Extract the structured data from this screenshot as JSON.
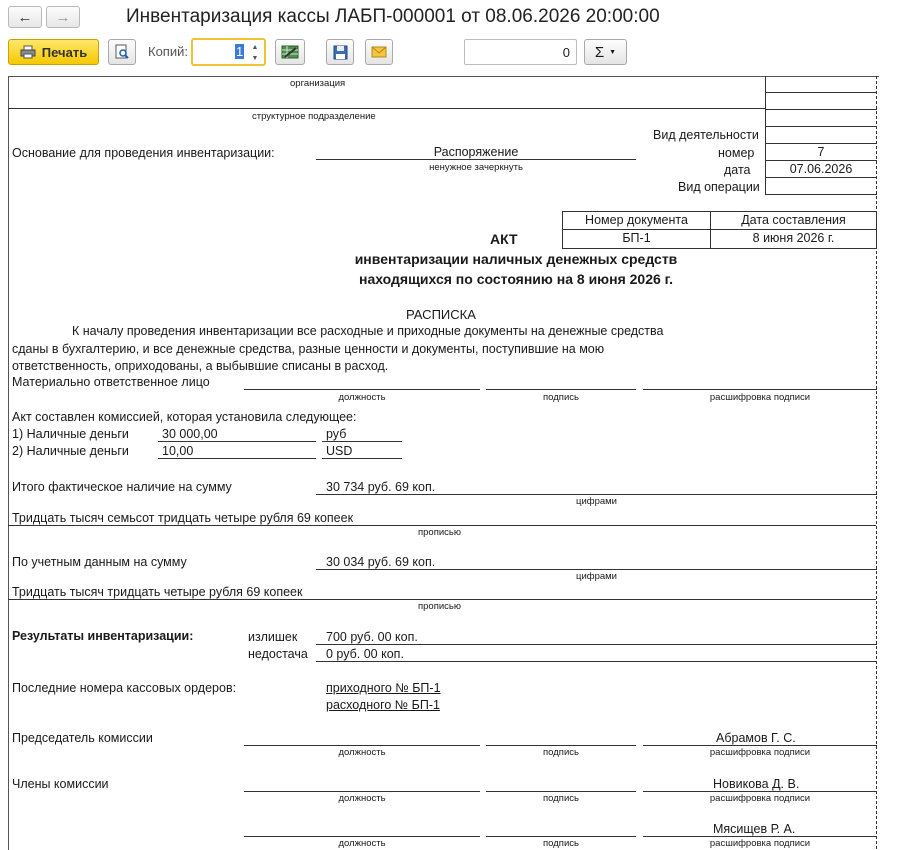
{
  "window": {
    "title": "Инвентаризация кассы ЛАБП-000001 от 08.06.2026 20:00:00",
    "back_icon": "arrow-left-icon",
    "forward_icon": "arrow-right-icon"
  },
  "toolbar": {
    "print_label": "Печать",
    "copies_label": "Копий:",
    "copies_value": "1",
    "sum_value": "0",
    "sigma_label": "Σ"
  },
  "doc": {
    "org_caption": "организация",
    "dept_caption": "структурное подразделение",
    "activity_label": "Вид деятельности",
    "basis_label": "Основание для проведения инвентаризации:",
    "basis_value": "Распоряжение",
    "basis_hint": "ненужное зачеркнуть",
    "number_label": "номер",
    "number_value": "7",
    "date_label": "дата",
    "date_value": "07.06.2026",
    "operation_label": "Вид операции",
    "docnum_header": "Номер документа",
    "docdate_header": "Дата составления",
    "docnum_value": "БП-1",
    "docdate_value": "8 июня 2026 г.",
    "act_title": "АКТ",
    "act_subtitle1": "инвентаризации наличных денежных средств",
    "act_subtitle2": "находящихся по состоянию на 8 июня 2026 г.",
    "receipt_title": "РАСПИСКА",
    "receipt_line1": "К началу проведения инвентаризации все расходные и приходные документы на денежные средства",
    "receipt_line2": "сданы в бухгалтерию, и все денежные средства, разные ценности и документы, поступившие на мою",
    "receipt_line3": "ответственность, оприходованы, а выбывшие списаны в расход.",
    "responsible_label": "Материально ответственное лицо",
    "cap_position": "должность",
    "cap_signature": "подпись",
    "cap_decoding": "расшифровка подписи",
    "commission_text": "Акт составлен комиссией, которая установила следующее:",
    "cash1_label": "1) Наличные деньги",
    "cash1_amount": "30 000,00",
    "cash1_currency": "руб",
    "cash2_label": "2) Наличные деньги",
    "cash2_amount": "10,00",
    "cash2_currency": "USD",
    "actual_label": "Итого фактическое наличие на сумму",
    "actual_value": "30 734 руб. 69 коп.",
    "cap_digits": "цифрами",
    "actual_words": "Тридцать тысяч семьсот тридцать четыре рубля 69 копеек",
    "cap_words": "прописью",
    "book_label": "По учетным данным на сумму",
    "book_value": "30 034 руб. 69 коп.",
    "book_words": "Тридцать тысяч тридцать четыре рубля 69 копеек",
    "results_label": "Результаты инвентаризации:",
    "surplus_label": "излишек",
    "surplus_value": "700 руб. 00 коп.",
    "shortage_label": "недостача",
    "shortage_value": "0 руб. 00 коп.",
    "last_orders_label": "Последние номера кассовых ордеров:",
    "incoming_order": "приходного № БП-1",
    "outgoing_order": "расходного № БП-1",
    "chairman_label": "Председатель комиссии",
    "chairman_name": "Абрамов Г. С.",
    "members_label": "Члены комиссии",
    "member1_name": "Новикова Д. В.",
    "member2_name": "Мясищев Р. А."
  }
}
